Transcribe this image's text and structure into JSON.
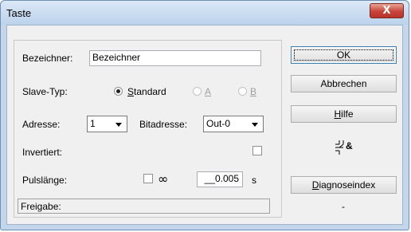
{
  "window": {
    "title": "Taste",
    "close_glyph": "X"
  },
  "fields": {
    "bezeichner_label": "Bezeichner:",
    "bezeichner_value": "Bezeichner",
    "slave_typ_label": "Slave-Typ:",
    "slave_typ_options": [
      {
        "pre": "",
        "u": "S",
        "post": "tandard",
        "selected": true,
        "enabled": true
      },
      {
        "pre": "",
        "u": "A",
        "post": "",
        "selected": false,
        "enabled": false
      },
      {
        "pre": "",
        "u": "B",
        "post": "",
        "selected": false,
        "enabled": false
      }
    ],
    "adresse_label": "Adresse:",
    "adresse_value": "1",
    "bitadresse_label": "Bitadresse:",
    "bitadresse_value": "Out-0",
    "invertiert_label": "Invertiert:",
    "invertiert_checked": false,
    "pulslaenge_label": "Pulslänge:",
    "infinity_symbol": "∞",
    "infinity_checked": false,
    "pulse_value": "__0.005",
    "pulse_unit": "s",
    "status_text": "Freigabe:"
  },
  "buttons": {
    "ok": "OK",
    "cancel": "Abbrechen",
    "help_pre": "",
    "help_u": "H",
    "help_post": "ilfe",
    "diag_pre": "",
    "diag_u": "D",
    "diag_post": "iagnoseindex",
    "diag_value": "-"
  },
  "icons": {
    "symbol_icon": "button-and-symbol",
    "symbol_text": "&"
  }
}
